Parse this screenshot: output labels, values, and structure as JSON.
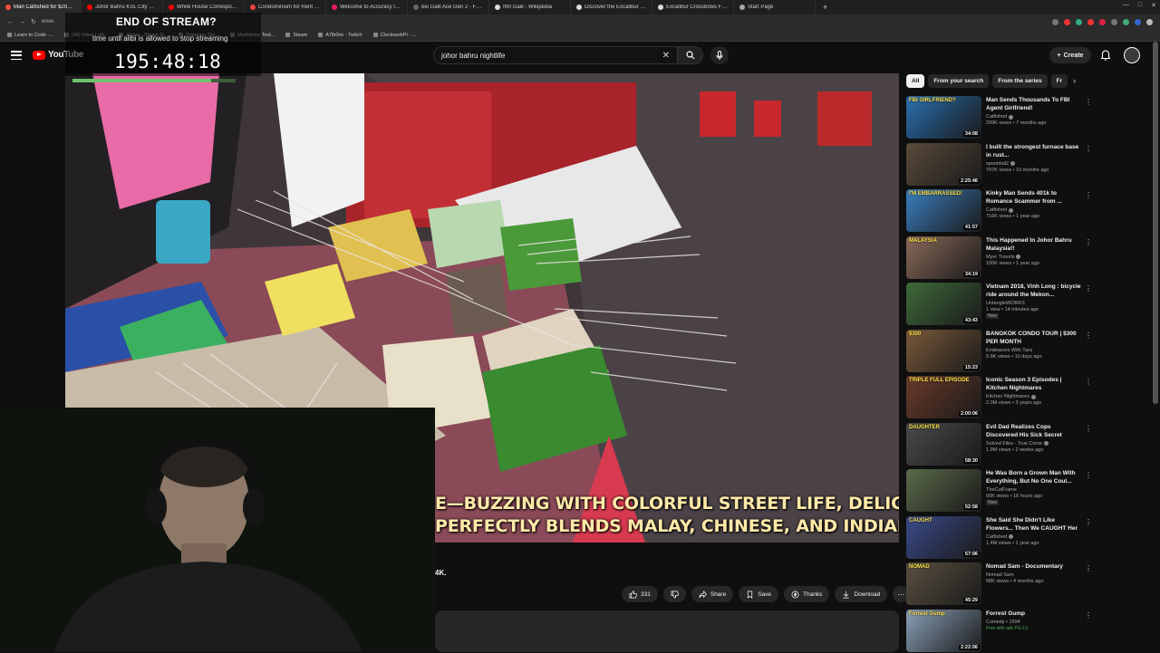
{
  "browser": {
    "tabs": [
      {
        "label": "Man Catfished for $200K, Y",
        "color": "#ff4e45",
        "active": true
      },
      {
        "label": "Johor Bahru KSL City 2025",
        "color": "#ff0000",
        "active": false
      },
      {
        "label": "White House Corresponde...",
        "color": "#ff0000",
        "active": false
      },
      {
        "label": "Condominium for Rent at F",
        "color": "#e44",
        "active": false
      },
      {
        "label": "Welcome to Accuracy Inter",
        "color": "#e91e63",
        "active": false
      },
      {
        "label": "bei Galil Ace Gen 2 - For Sa",
        "color": "#666",
        "active": false
      },
      {
        "label": "IWI Galil - Wikipedia",
        "color": "#ddd",
        "active": false
      },
      {
        "label": "Discover the Excalibur Meg",
        "color": "#ddd",
        "active": false
      },
      {
        "label": "Excalibur Crossbows From",
        "color": "#ddd",
        "active": false
      },
      {
        "label": "Start Page",
        "color": "#aaa",
        "active": false
      }
    ],
    "url": "www.",
    "bookmarks": [
      "Learn to Code -...",
      "(48) Inbox | stil...",
      "Home - Steam D...",
      "Snappea Tim...",
      "Markdown Text...",
      "Steam",
      "A7lb0rix - Twitch",
      "ClockworkPi - ..."
    ]
  },
  "header": {
    "logo_text": "YouTube",
    "search_value": "johor bahru nightlife",
    "create_label": "Create"
  },
  "overlay": {
    "title": "END OF STREAM?",
    "subtitle": "time until alibi is allowed to stop streaming",
    "countdown": "195:48:18",
    "progress": 0.85
  },
  "player": {
    "caption_line1": "E—BUZZING WITH COLORFUL STREET LIFE, DELICIOUS LOCAL",
    "caption_line2": "PERFECTLY BLENDS MALAY, CHINESE, AND INDIAN CULTURES."
  },
  "below": {
    "title_fragment": "4K.",
    "like_count": "331",
    "share_label": "Share",
    "save_label": "Save",
    "thanks_label": "Thanks",
    "download_label": "Download"
  },
  "chips": [
    "All",
    "From your search",
    "From the series",
    "Fr"
  ],
  "recommendations": [
    {
      "title": "Man Sends Thousands To FBI Agent Girlfriend!",
      "channel": "Catfished",
      "verified": true,
      "meta": "299K views • 7 months ago",
      "duration": "34:08",
      "thumb_text": "FBI GIRLFRIEND?",
      "thumb_color": "#2a6fb0",
      "badge": ""
    },
    {
      "title": "I built the strongest furnace base in rust...",
      "channel": "spoonkid2",
      "verified": true,
      "meta": "797K views • 10 months ago",
      "duration": "2:25:46",
      "thumb_text": "",
      "thumb_color": "#5a4a3a",
      "badge": ""
    },
    {
      "title": "Kinky Man Sends 401k to Romance Scammer from ...",
      "channel": "Catfished",
      "verified": true,
      "meta": "716K views • 1 year ago",
      "duration": "41:57",
      "thumb_text": "I'M EMBARRASSED!",
      "thumb_color": "#3a7fc0",
      "badge": ""
    },
    {
      "title": "This Happened In Johor Bahru Malaysia!!",
      "channel": "Myer Travels",
      "verified": true,
      "meta": "100K views • 1 year ago",
      "duration": "34:19",
      "thumb_text": "MALAYSIA",
      "thumb_color": "#8a6a5a",
      "badge": ""
    },
    {
      "title": "Vietnam 2018, Vinh Long : bicycle ride around the Mekon...",
      "channel": "UntangleWORKS",
      "verified": false,
      "meta": "1 view • 14 minutes ago",
      "duration": "43:43",
      "thumb_text": "",
      "thumb_color": "#3f6a3a",
      "badge": "New"
    },
    {
      "title": "BANGKOK CONDO TOUR | $300 PER MONTH",
      "channel": "Endeavors With Tara",
      "verified": false,
      "meta": "5.9K views • 10 days ago",
      "duration": "15:23",
      "thumb_text": "$300",
      "thumb_color": "#7a5a3a",
      "badge": ""
    },
    {
      "title": "Iconic Season 3 Episodes | Kitchen Nightmares",
      "channel": "Kitchen Nightmares",
      "verified": true,
      "meta": "2.3M views • 3 years ago",
      "duration": "2:00:06",
      "thumb_text": "TRIPLE FULL EPISODE",
      "thumb_color": "#6a3a2a",
      "badge": ""
    },
    {
      "title": "Evil Dad Realizes Cops Discovered His Sick Secret",
      "channel": "Solved Files - True Crime",
      "verified": true,
      "meta": "1.9M views • 2 weeks ago",
      "duration": "58:30",
      "thumb_text": "DAUGHTER",
      "thumb_color": "#4a4a4a",
      "badge": ""
    },
    {
      "title": "He Was Born a Grown Man With Everything, But No One Coul...",
      "channel": "TheCutFrame",
      "verified": false,
      "meta": "66K views • 16 hours ago",
      "duration": "52:58",
      "thumb_text": "",
      "thumb_color": "#5a6a4a",
      "badge": "New"
    },
    {
      "title": "She Said She Didn't Like Flowers... Then We CAUGHT Her",
      "channel": "Catfished",
      "verified": true,
      "meta": "1.4M views • 1 year ago",
      "duration": "57:06",
      "thumb_text": "CAUGHT",
      "thumb_color": "#3a4a8a",
      "badge": ""
    },
    {
      "title": "Nomad Sam - Documentary",
      "channel": "Nomad Sam",
      "verified": false,
      "meta": "68K views • 4 months ago",
      "duration": "45:29",
      "thumb_text": "NOMAD",
      "thumb_color": "#5a5040",
      "badge": ""
    },
    {
      "title": "Forrest Gump",
      "channel": "Comedy • 1994",
      "verified": false,
      "meta": "",
      "duration": "2:22:06",
      "thumb_text": "Forrest Gump",
      "thumb_color": "#8aa0b8",
      "badge": "Free with ads  PG-13"
    }
  ],
  "colors": {
    "accent": "#ff0000",
    "caption": "#ffe9a8",
    "timer_bar": "#6fc06f"
  }
}
